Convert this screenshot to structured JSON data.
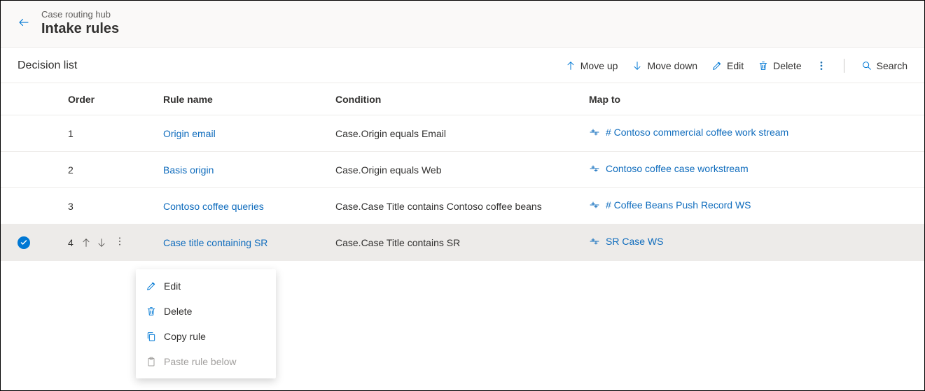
{
  "header": {
    "breadcrumb": "Case routing hub",
    "title": "Intake rules"
  },
  "toolbar": {
    "title": "Decision list",
    "move_up": "Move up",
    "move_down": "Move down",
    "edit": "Edit",
    "delete": "Delete",
    "search": "Search"
  },
  "columns": {
    "order": "Order",
    "rule": "Rule name",
    "condition": "Condition",
    "map": "Map to"
  },
  "rows": [
    {
      "order": "1",
      "rule": "Origin email",
      "condition": "Case.Origin equals Email",
      "map": "# Contoso commercial coffee work stream",
      "selected": false
    },
    {
      "order": "2",
      "rule": "Basis origin",
      "condition": "Case.Origin equals Web",
      "map": "Contoso coffee case workstream",
      "selected": false
    },
    {
      "order": "3",
      "rule": "Contoso coffee queries",
      "condition": "Case.Case Title contains Contoso coffee beans",
      "map": "# Coffee Beans Push Record WS",
      "selected": false
    },
    {
      "order": "4",
      "rule": "Case title containing SR",
      "condition": "Case.Case Title contains SR",
      "map": "SR Case WS",
      "selected": true
    }
  ],
  "context_menu": {
    "edit": "Edit",
    "delete": "Delete",
    "copy": "Copy rule",
    "paste": "Paste rule below"
  }
}
